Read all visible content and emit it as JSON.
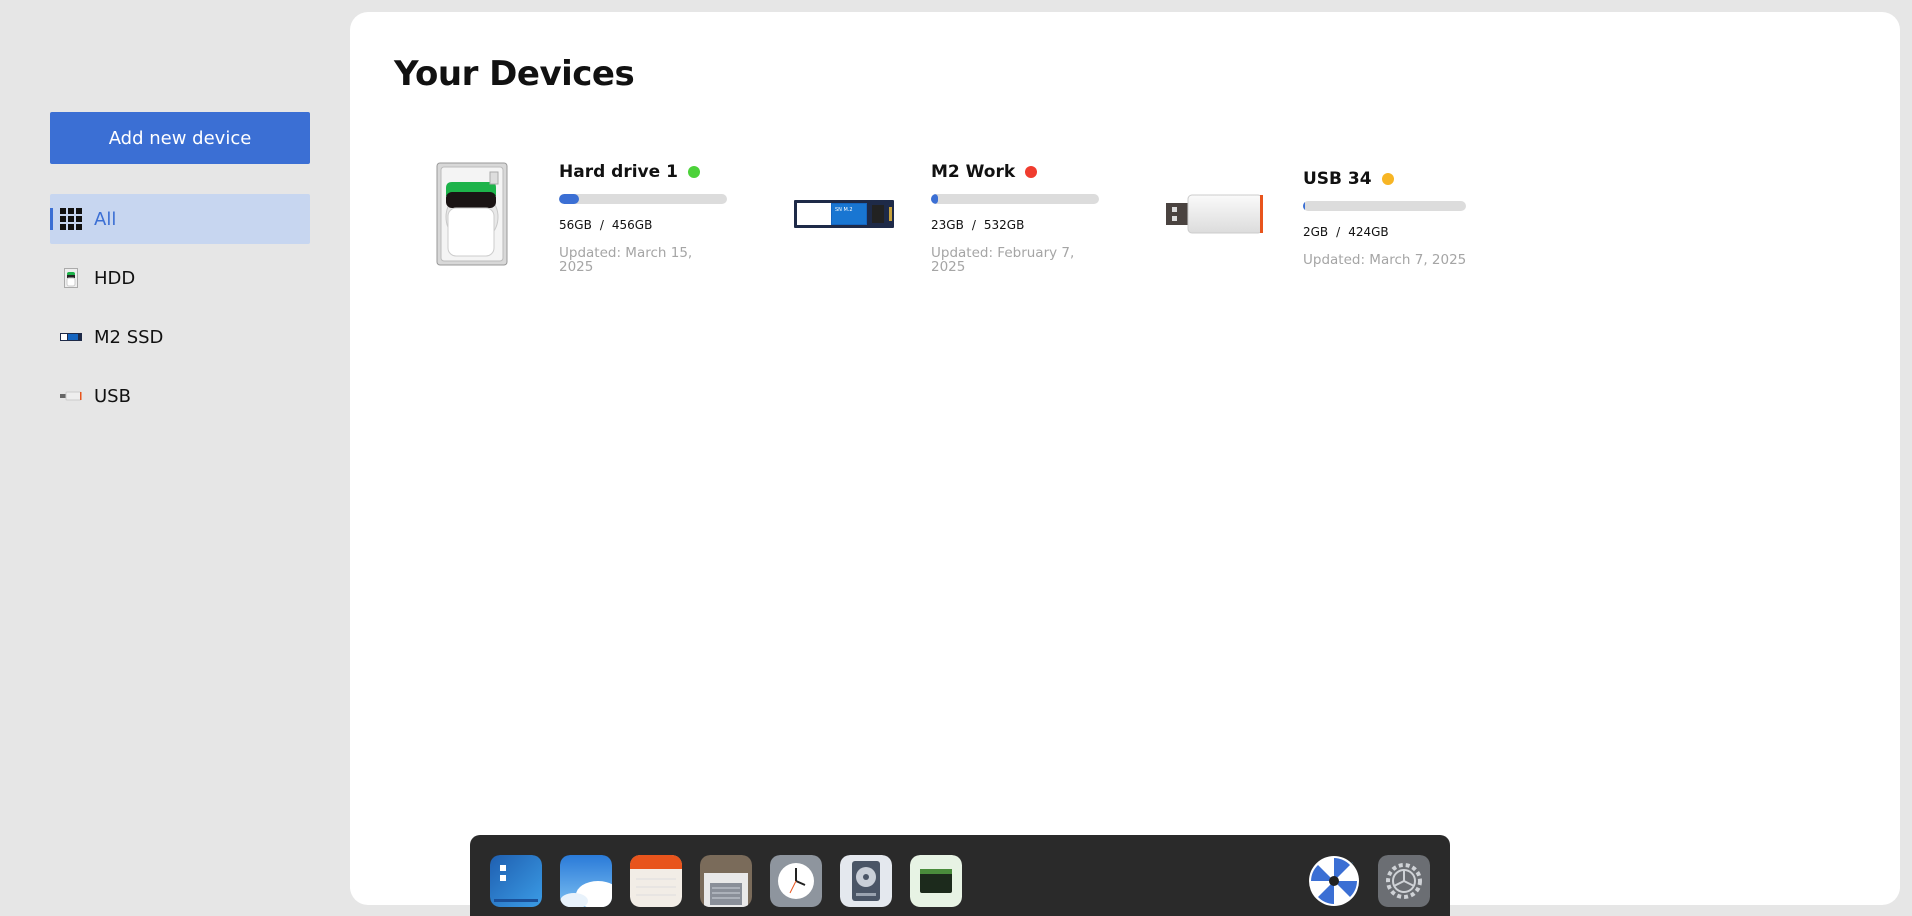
{
  "sidebar": {
    "add_button_label": "Add new device",
    "items": [
      {
        "label": "All",
        "icon": "grid-icon",
        "active": true
      },
      {
        "label": "HDD",
        "icon": "hdd-icon"
      },
      {
        "label": "M2 SSD",
        "icon": "ssd-icon"
      },
      {
        "label": "USB",
        "icon": "usb-icon"
      }
    ]
  },
  "main": {
    "title": "Your Devices",
    "devices": [
      {
        "name": "Hard drive 1",
        "status_color": "#4cd23a",
        "used": "56GB",
        "total": "456GB",
        "usage_fraction": 0.12,
        "updated": "Updated: March 15, 2025",
        "icon": "hard-drive-image"
      },
      {
        "name": "M2 Work",
        "status_color": "#f03c2e",
        "used": "23GB",
        "total": "532GB",
        "usage_fraction": 0.04,
        "updated": "Updated: February 7, 2025",
        "icon": "m2-ssd-image"
      },
      {
        "name": "USB 34",
        "status_color": "#f7b524",
        "used": "2GB",
        "total": "424GB",
        "usage_fraction": 0.01,
        "updated": "Updated: March 7, 2025",
        "icon": "usb-drive-image"
      }
    ],
    "capacity_separator": "/"
  },
  "dock": {
    "apps": [
      "files-app-icon",
      "weather-app-icon",
      "notes-app-icon",
      "archive-app-icon",
      "clock-app-icon",
      "disks-app-icon",
      "terminal-app-icon",
      "launcher-icon",
      "settings-app-icon"
    ]
  },
  "colors": {
    "accent": "#3b6fd4",
    "active_nav_bg": "#c7d6f0",
    "background": "#e6e6e6"
  }
}
